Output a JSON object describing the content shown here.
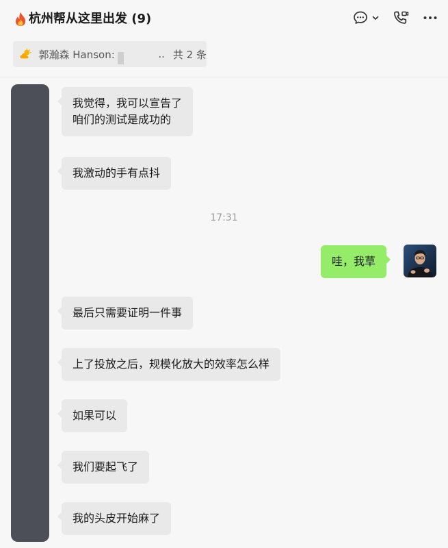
{
  "header": {
    "title": "杭州帮从这里出发 (9)",
    "icons": [
      "fire-emoji",
      "chat-bubble-icon",
      "chevron-down-icon",
      "phone-video-icon",
      "more-icon"
    ]
  },
  "pinned": {
    "sender": "郭瀚森 Hanson:",
    "ellipsis": "..",
    "count": "共 2 条"
  },
  "messages": [
    {
      "side": "left",
      "text": "我觉得，我可以宣告了\n咱们的测试是成功的"
    },
    {
      "side": "left",
      "text": "我激动的手有点抖"
    },
    {
      "type": "time",
      "text": "17:31"
    },
    {
      "side": "right",
      "text": "哇，我草"
    },
    {
      "side": "left",
      "text": "最后只需要证明一件事"
    },
    {
      "side": "left",
      "text": "上了投放之后，规模化放大的效率怎么样"
    },
    {
      "side": "left",
      "text": "如果可以"
    },
    {
      "side": "left",
      "text": "我们要起飞了"
    },
    {
      "side": "left",
      "text": "我的头皮开始麻了"
    }
  ],
  "colors": {
    "incoming_bubble": "#e9e9e9",
    "outgoing_bubble": "#95ec69",
    "background": "#f7f7f7",
    "redacted_avatar": "#4c4f58"
  }
}
